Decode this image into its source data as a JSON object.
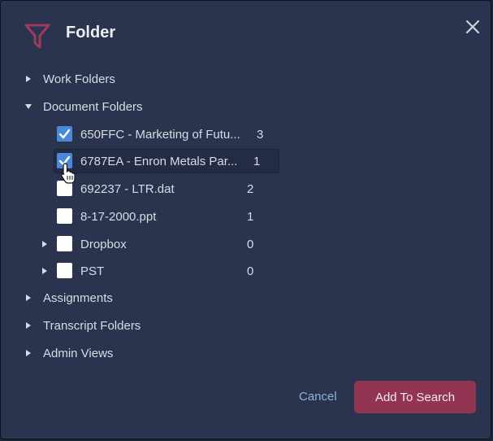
{
  "dialog": {
    "title": "Folder",
    "icon": "filter-funnel-icon",
    "accent_color": "#913553"
  },
  "tree": {
    "items": [
      {
        "label": "Work Folders",
        "expanded": false
      },
      {
        "label": "Document Folders",
        "expanded": true,
        "children": [
          {
            "label": "650FFC - Marketing of Futu...",
            "count": "3",
            "checked": true
          },
          {
            "label": "6787EA - Enron Metals Par...",
            "count": "1",
            "checked": true,
            "hovered": true
          },
          {
            "label": "692237 - LTR.dat",
            "count": "2",
            "checked": false
          },
          {
            "label": "8-17-2000.ppt",
            "count": "1",
            "checked": false
          },
          {
            "label": "Dropbox",
            "count": "0",
            "checked": false,
            "expandable": true
          },
          {
            "label": "PST",
            "count": "0",
            "checked": false,
            "expandable": true
          }
        ]
      },
      {
        "label": "Assignments",
        "expanded": false
      },
      {
        "label": "Transcript Folders",
        "expanded": false
      },
      {
        "label": "Admin Views",
        "expanded": false
      }
    ]
  },
  "footer": {
    "cancel_label": "Cancel",
    "submit_label": "Add To Search"
  }
}
